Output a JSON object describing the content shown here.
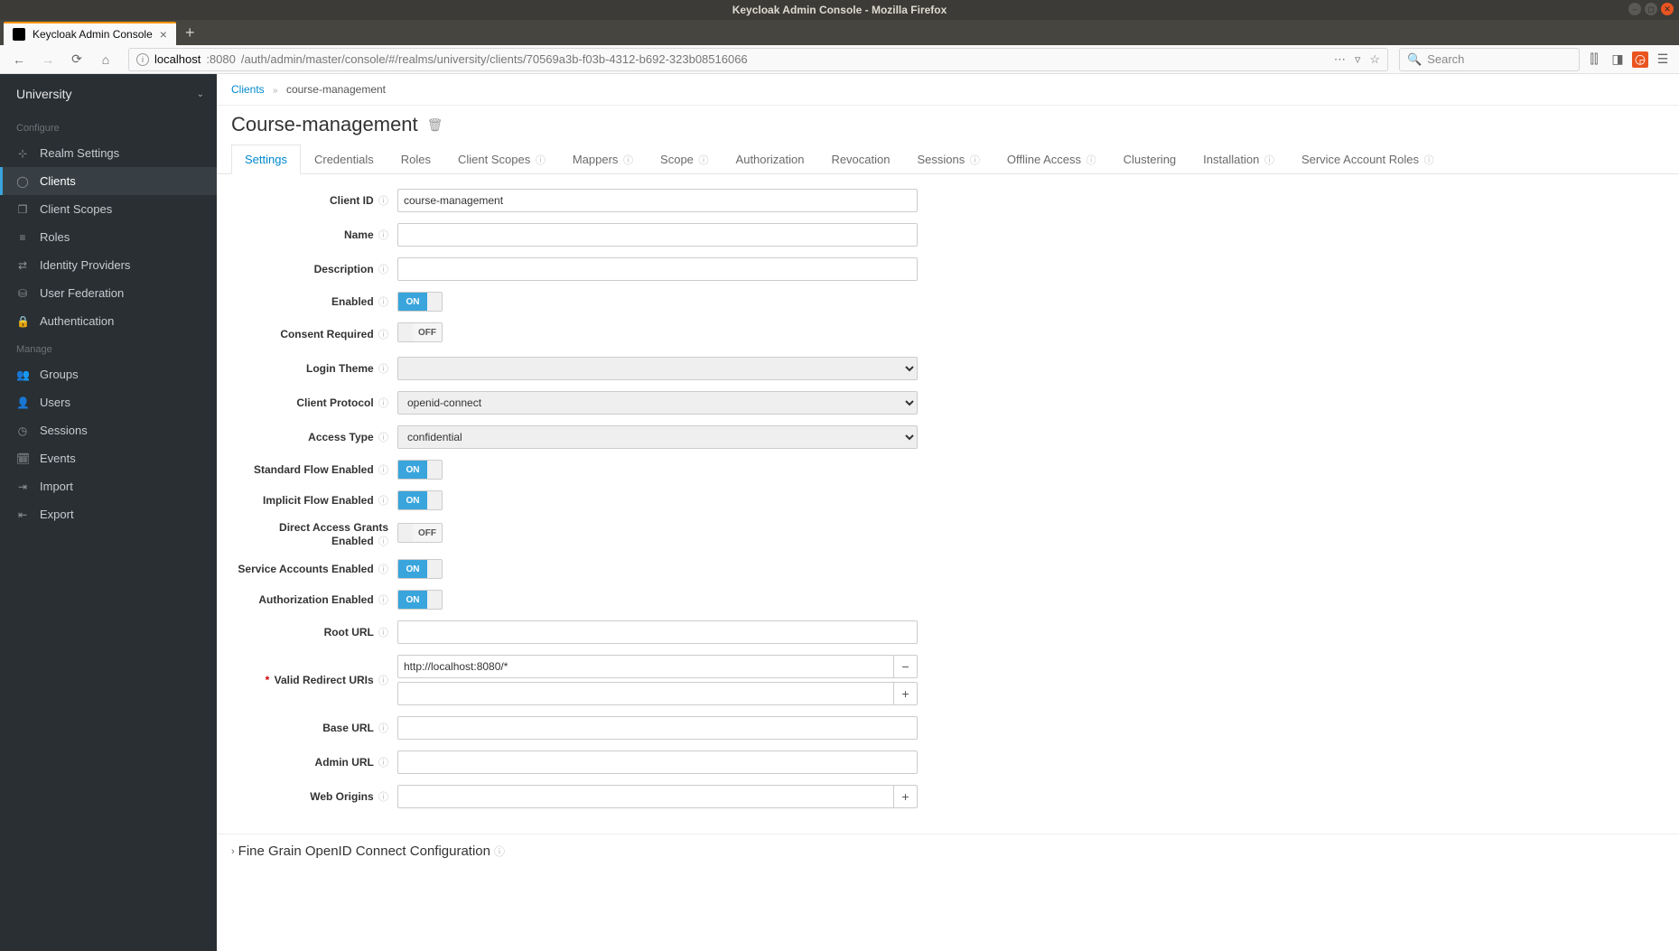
{
  "os": {
    "windowTitle": "Keycloak Admin Console - Mozilla Firefox"
  },
  "browser": {
    "tabTitle": "Keycloak Admin Console",
    "urlHost": "localhost",
    "urlPort": ":8080",
    "urlPath": "/auth/admin/master/console/#/realms/university/clients/70569a3b-f03b-4312-b692-323b08516066",
    "searchPlaceholder": "Search"
  },
  "sidebar": {
    "realm": "University",
    "sections": {
      "configure": {
        "label": "Configure",
        "items": [
          {
            "label": "Realm Settings",
            "icon": "sliders"
          },
          {
            "label": "Clients",
            "icon": "circle",
            "active": true
          },
          {
            "label": "Client Scopes",
            "icon": "pages"
          },
          {
            "label": "Roles",
            "icon": "stack"
          },
          {
            "label": "Identity Providers",
            "icon": "exchange"
          },
          {
            "label": "User Federation",
            "icon": "database"
          },
          {
            "label": "Authentication",
            "icon": "lock"
          }
        ]
      },
      "manage": {
        "label": "Manage",
        "items": [
          {
            "label": "Groups",
            "icon": "users"
          },
          {
            "label": "Users",
            "icon": "user"
          },
          {
            "label": "Sessions",
            "icon": "clock"
          },
          {
            "label": "Events",
            "icon": "calendar"
          },
          {
            "label": "Import",
            "icon": "import"
          },
          {
            "label": "Export",
            "icon": "export"
          }
        ]
      }
    }
  },
  "breadcrumb": {
    "parent": "Clients",
    "current": "course-management"
  },
  "page": {
    "title": "Course-management"
  },
  "tabs": [
    {
      "label": "Settings",
      "active": true
    },
    {
      "label": "Credentials"
    },
    {
      "label": "Roles"
    },
    {
      "label": "Client Scopes",
      "help": true
    },
    {
      "label": "Mappers",
      "help": true
    },
    {
      "label": "Scope",
      "help": true
    },
    {
      "label": "Authorization"
    },
    {
      "label": "Revocation"
    },
    {
      "label": "Sessions",
      "help": true
    },
    {
      "label": "Offline Access",
      "help": true
    },
    {
      "label": "Clustering"
    },
    {
      "label": "Installation",
      "help": true
    },
    {
      "label": "Service Account Roles",
      "help": true
    }
  ],
  "form": {
    "clientId": {
      "label": "Client ID",
      "value": "course-management"
    },
    "name": {
      "label": "Name",
      "value": ""
    },
    "description": {
      "label": "Description",
      "value": ""
    },
    "enabled": {
      "label": "Enabled",
      "on": true
    },
    "consentRequired": {
      "label": "Consent Required",
      "on": false
    },
    "loginTheme": {
      "label": "Login Theme",
      "value": ""
    },
    "clientProtocol": {
      "label": "Client Protocol",
      "value": "openid-connect"
    },
    "accessType": {
      "label": "Access Type",
      "value": "confidential"
    },
    "standardFlow": {
      "label": "Standard Flow Enabled",
      "on": true
    },
    "implicitFlow": {
      "label": "Implicit Flow Enabled",
      "on": true
    },
    "directAccess": {
      "label": "Direct Access Grants Enabled",
      "on": false
    },
    "serviceAccounts": {
      "label": "Service Accounts Enabled",
      "on": true
    },
    "authorization": {
      "label": "Authorization Enabled",
      "on": true
    },
    "rootUrl": {
      "label": "Root URL",
      "value": ""
    },
    "validRedirectUris": {
      "label": "Valid Redirect URIs",
      "required": true,
      "values": [
        "http://localhost:8080/*"
      ]
    },
    "baseUrl": {
      "label": "Base URL",
      "value": ""
    },
    "adminUrl": {
      "label": "Admin URL",
      "value": ""
    },
    "webOrigins": {
      "label": "Web Origins",
      "value": ""
    }
  },
  "collapsible": {
    "fineGrain": "Fine Grain OpenID Connect Configuration"
  },
  "toggleLabels": {
    "on": "ON",
    "off": "OFF"
  }
}
